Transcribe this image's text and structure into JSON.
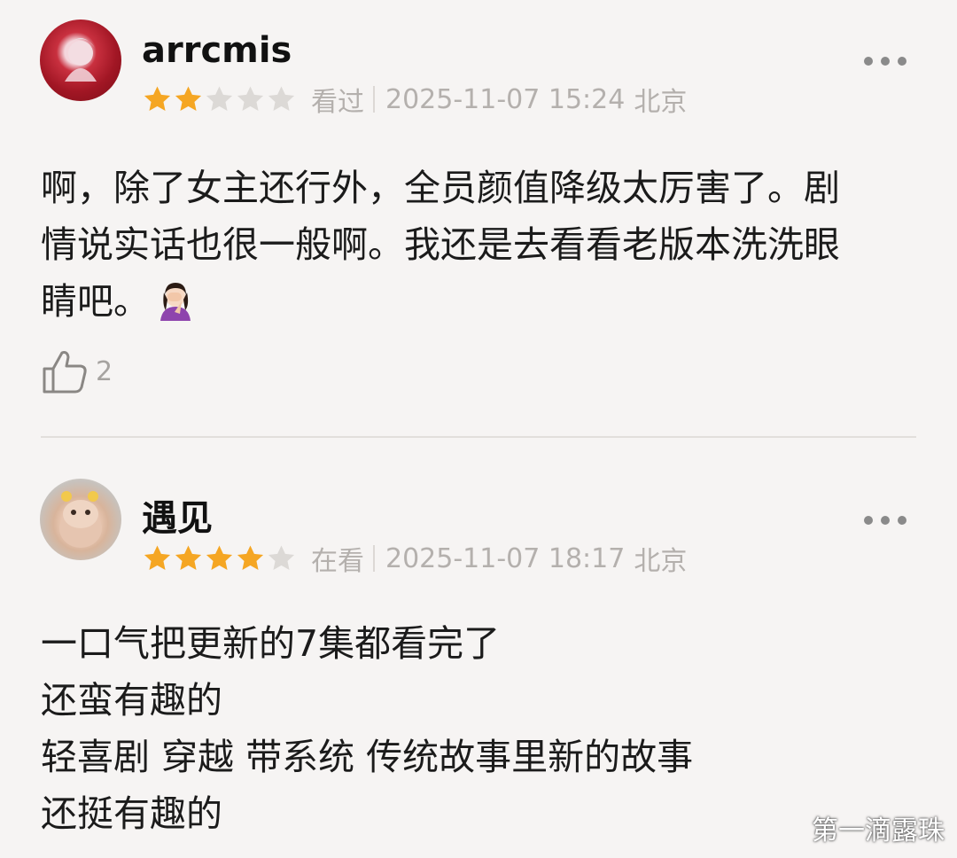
{
  "reviews": [
    {
      "username": "arrcmis",
      "rating": 2,
      "max_rating": 5,
      "status": "看过",
      "datetime": "2025-11-07 15:24",
      "location": "北京",
      "lines": [
        "啊，除了女主还行外，全员颜值降级太厉害了。剧",
        "情说实话也很一般啊。我还是去看看老版本洗洗眼",
        "睛吧。"
      ],
      "emoji": "face-palm-emoji",
      "likes": "2"
    },
    {
      "username": "遇见",
      "rating": 4,
      "max_rating": 5,
      "status": "在看",
      "datetime": "2025-11-07 18:17",
      "location": "北京",
      "lines": [
        "一口气把更新的7集都看完了",
        "还蛮有趣的",
        "轻喜剧 穿越 带系统 传统故事里新的故事",
        "还挺有趣的"
      ]
    }
  ],
  "watermark": "第一滴露珠",
  "colors": {
    "star_filled": "#f5a623",
    "star_empty": "#dcd9d6",
    "meta_text": "#b4b0ad",
    "background": "#f6f4f3"
  }
}
